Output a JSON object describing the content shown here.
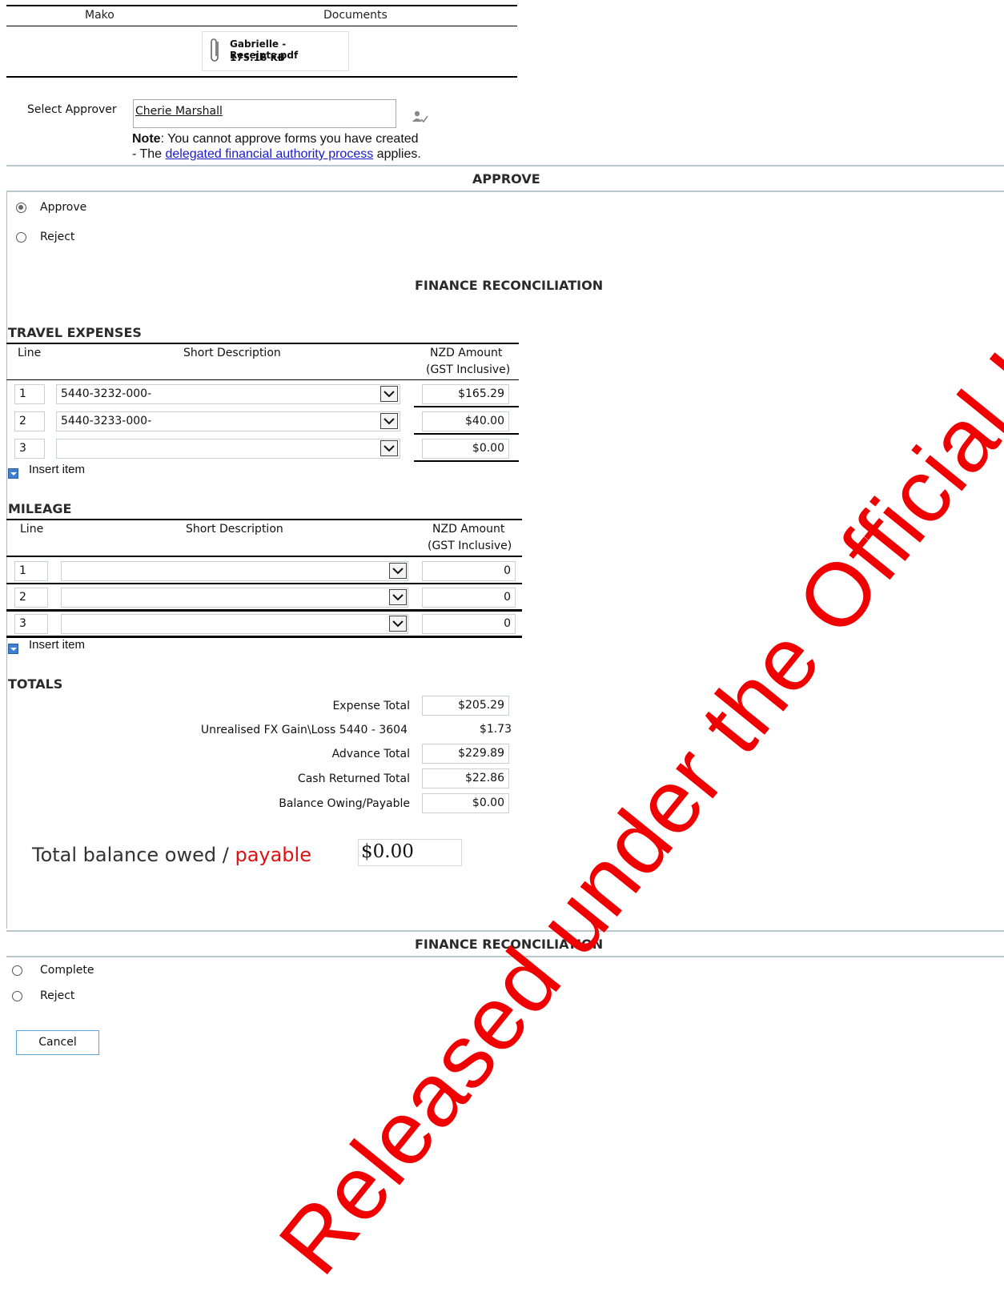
{
  "top": {
    "col1": "Mako",
    "col2": "Documents",
    "attachment_name": "Gabrielle - Receipts.pdf",
    "attachment_size": "175.16 KB"
  },
  "approver": {
    "label": "Select Approver",
    "value": "Cherie Marshall",
    "note_bold": "Note",
    "note_rest": ": You cannot approve forms you have created",
    "note_line2_pre": "- The ",
    "note_link": "delegated financial authority process",
    "note_line2_post": " applies."
  },
  "approve_section": {
    "title": "APPROVE",
    "options": [
      "Approve",
      "Reject"
    ],
    "selected": "Approve"
  },
  "finance_title": "FINANCE RECONCILIATION",
  "travel": {
    "title": "TRAVEL EXPENSES",
    "headers": {
      "line": "Line",
      "desc": "Short Description",
      "amount1": "NZD Amount",
      "amount2": "(GST Inclusive)"
    },
    "rows": [
      {
        "line": "1",
        "desc": "5440-3232-000-",
        "amount": "$165.29"
      },
      {
        "line": "2",
        "desc": "5440-3233-000-",
        "amount": "$40.00"
      },
      {
        "line": "3",
        "desc": "",
        "amount": "$0.00"
      }
    ],
    "insert_label": "Insert item"
  },
  "mileage": {
    "title": "MILEAGE",
    "headers": {
      "line": "Line",
      "desc": "Short Description",
      "amount1": "NZD Amount",
      "amount2": "(GST Inclusive)"
    },
    "rows": [
      {
        "line": "1",
        "desc": "",
        "amount": "0"
      },
      {
        "line": "2",
        "desc": "",
        "amount": "0"
      },
      {
        "line": "3",
        "desc": "",
        "amount": "0"
      }
    ],
    "insert_label": "Insert item"
  },
  "totals": {
    "title": "TOTALS",
    "expense_label": "Expense Total",
    "expense_value": "$205.29",
    "fx_label": "Unrealised FX Gain\\Loss 5440 - 3604",
    "fx_value": "$1.73",
    "advance_label": "Advance Total",
    "advance_value": "$229.89",
    "cash_label": "Cash Returned Total",
    "cash_value": "$22.86",
    "balance_label": "Balance Owing/Payable",
    "balance_value": "$0.00"
  },
  "big_balance": {
    "label_part1": "Total balance owed / ",
    "label_part2": "payable",
    "value": "$0.00"
  },
  "finance_bottom": {
    "title": "FINANCE RECONCILIATION",
    "options": [
      "Complete",
      "Reject"
    ]
  },
  "cancel_label": "Cancel",
  "watermark": "Released under the Official Information Act",
  "colors": {
    "link": "#1a1acc",
    "red": "#e01010",
    "grey_rule": "#b9c6cc"
  }
}
